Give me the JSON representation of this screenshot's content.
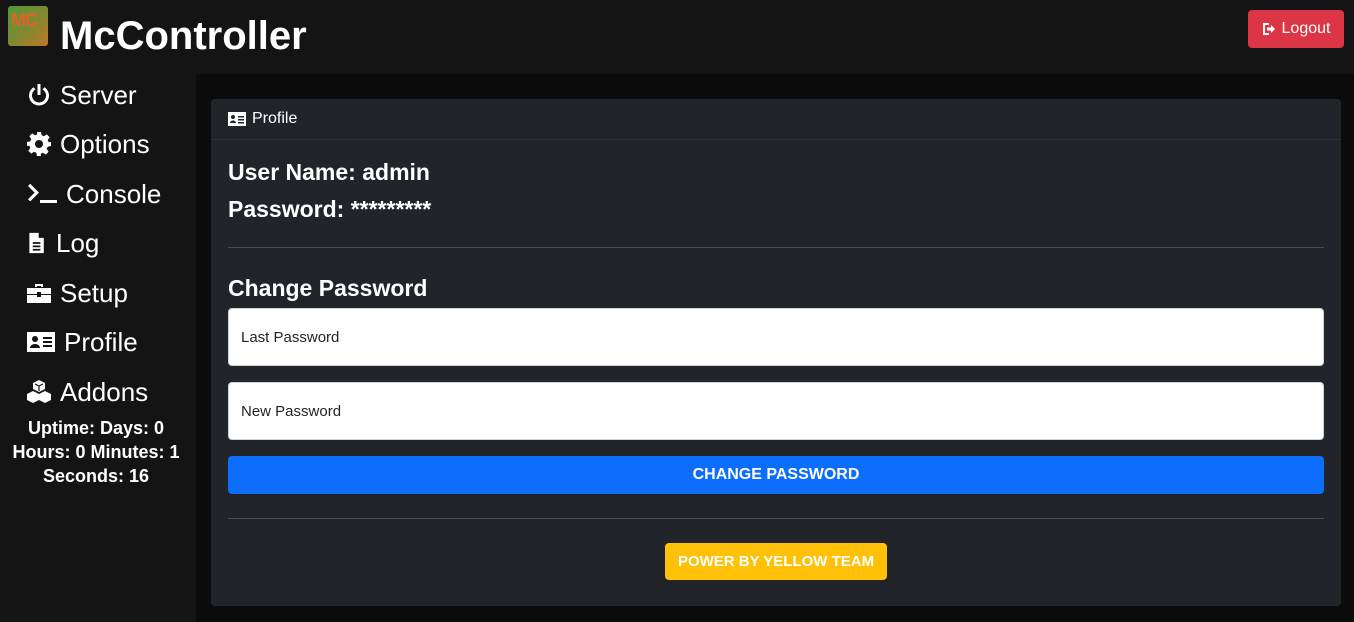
{
  "header": {
    "logo_text": "MC",
    "title": "McController",
    "logout_label": "Logout"
  },
  "sidebar": {
    "items": [
      {
        "label": "Server",
        "icon": "power-icon"
      },
      {
        "label": "Options",
        "icon": "gear-icon"
      },
      {
        "label": "Console",
        "icon": "terminal-icon"
      },
      {
        "label": "Log",
        "icon": "file-icon"
      },
      {
        "label": "Setup",
        "icon": "toolbox-icon"
      },
      {
        "label": "Profile",
        "icon": "id-card-icon"
      },
      {
        "label": "Addons",
        "icon": "cubes-icon"
      }
    ],
    "uptime": {
      "line1": "Uptime: Days: 0",
      "line2": "Hours: 0 Minutes: 1",
      "line3": "Seconds: 16"
    }
  },
  "profile": {
    "header_label": "Profile",
    "username_line": "User Name: admin",
    "password_line": "Password: *********",
    "change_title": "Change Password",
    "last_password_placeholder": "Last Password",
    "new_password_placeholder": "New Password",
    "change_button": "CHANGE PASSWORD",
    "power_button": "POWER BY YELLOW TEAM"
  },
  "colors": {
    "background": "#141414",
    "card": "#212529",
    "logout": "#dc3545",
    "primary": "#0d6efd",
    "warning": "#ffc107"
  }
}
